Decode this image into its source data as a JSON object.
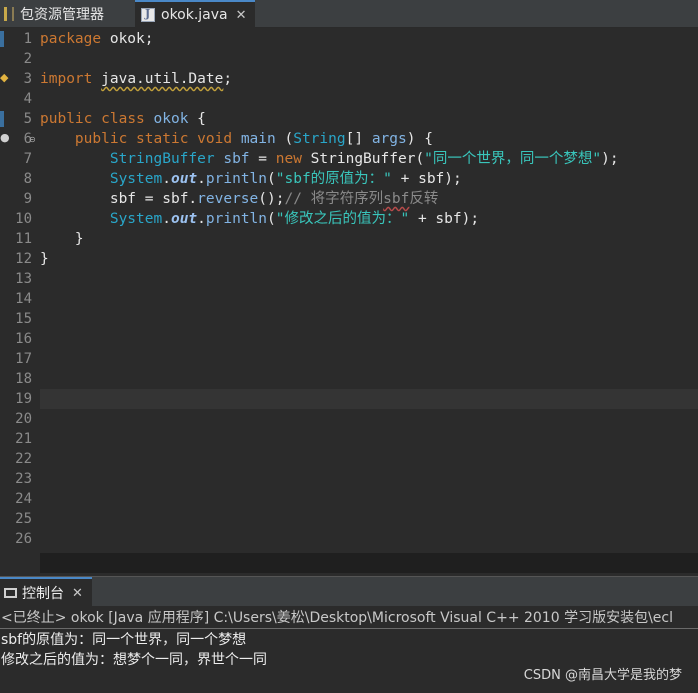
{
  "tabs": {
    "package_explorer": "包资源管理器",
    "editor_file": "okok.java",
    "close_glyph": "✕"
  },
  "editor": {
    "line_numbers": [
      "1",
      "2",
      "3",
      "4",
      "5",
      "6",
      "7",
      "8",
      "9",
      "10",
      "11",
      "12",
      "13",
      "14",
      "15",
      "16",
      "17",
      "18",
      "19",
      "20",
      "21",
      "22",
      "23",
      "24",
      "25",
      "26"
    ],
    "code": {
      "l1": {
        "kw": "package",
        "rest": " okok;"
      },
      "l3": {
        "kw": "import",
        "path": "java.util.Date",
        "end": ";"
      },
      "l5": {
        "kw1": "public",
        "kw2": "class",
        "name": "okok",
        "brace": " {"
      },
      "l6": {
        "kw1": "public",
        "kw2": "static",
        "kw3": "void",
        "name": "main",
        "p1": " (",
        "type": "String",
        "p2": "[] ",
        "arg": "args",
        "p3": ") {"
      },
      "l7": {
        "type": "StringBuffer",
        "var": " sbf",
        "eq": " = ",
        "kw": "new",
        "ctor": " StringBuffer",
        "p1": "(",
        "str": "\"同一个世界，同一个梦想\"",
        "p2": ");"
      },
      "l8": {
        "sys": "System",
        "dot1": ".",
        "out": "out",
        "dot2": ".",
        "fn": "println",
        "p1": "(",
        "str": "\"sbf的原值为：\"",
        "plus": " + sbf);"
      },
      "l9": {
        "var": "sbf",
        "eq": " = sbf.",
        "fn": "reverse",
        "p": "();",
        "comment1": "// 将字符序列",
        "comment_sq": "sbf",
        "comment2": "反转"
      },
      "l10": {
        "sys": "System",
        "dot1": ".",
        "out": "out",
        "dot2": ".",
        "fn": "println",
        "p1": "(",
        "str": "\"修改之后的值为：\"",
        "plus": " + sbf);"
      },
      "l11": "}",
      "l12": "}"
    }
  },
  "console": {
    "tab_label": "控制台",
    "status": "<已终止> okok [Java 应用程序] C:\\Users\\姜松\\Desktop\\Microsoft Visual C++ 2010 学习版安装包\\ecl",
    "output": [
      "sbf的原值为：同一个世界，同一个梦想",
      "修改之后的值为：想梦个一同，界世个一同"
    ]
  },
  "watermark": "CSDN @南昌大学是我的梦",
  "colors": {
    "background": "#2b2b2b",
    "keyword": "#cc7832",
    "type": "#29a6c9",
    "string": "#39c5bb",
    "comment": "#8a8a8a"
  }
}
